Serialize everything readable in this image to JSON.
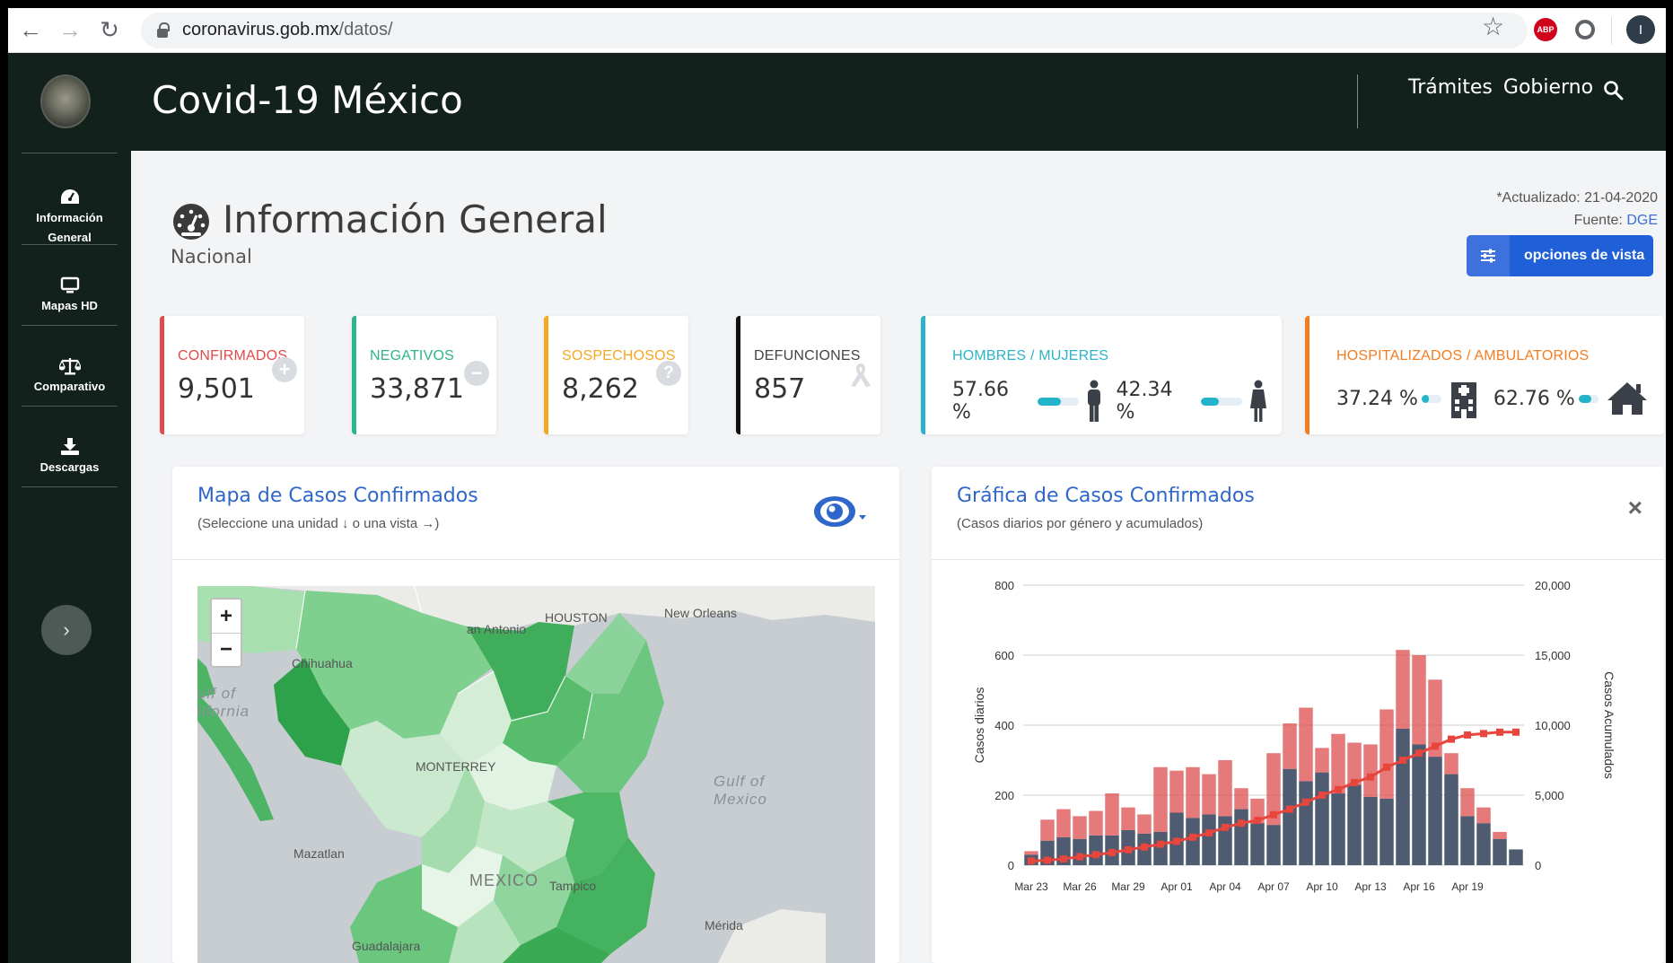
{
  "browser": {
    "url_domain": "coronavirus.gob.mx",
    "url_path": "/datos/",
    "abp_label": "ABP",
    "profile_initial": "I"
  },
  "header": {
    "title": "Covid-19 México",
    "nav": [
      "Trámites",
      "Gobierno"
    ]
  },
  "sidebar": {
    "items": [
      {
        "label_line1": "Información",
        "label_line2": "General",
        "icon": "gauge-icon"
      },
      {
        "label_line1": "Mapas HD",
        "label_line2": "",
        "icon": "monitor-icon"
      },
      {
        "label_line1": "Comparativo",
        "label_line2": "",
        "icon": "balance-scale-icon"
      },
      {
        "label_line1": "Descargas",
        "label_line2": "",
        "icon": "download-icon"
      }
    ],
    "toggle_glyph": "›"
  },
  "page": {
    "title": "Información General",
    "subtitle": "Nacional",
    "updated": "*Actualizado: 21-04-2020",
    "source_label": "Fuente:",
    "source_value": "DGE",
    "options_label": "opciones de vista"
  },
  "cards": {
    "confirmados": {
      "label": "CONFIRMADOS",
      "value": "9,501",
      "color": "#e04b4b"
    },
    "negativos": {
      "label": "NEGATIVOS",
      "value": "33,871",
      "color": "#2cb58a"
    },
    "sospechosos": {
      "label": "SOSPECHOSOS",
      "value": "8,262",
      "color": "#f5a623"
    },
    "defunciones": {
      "label": "DEFUNCIONES",
      "value": "857",
      "color": "#111111"
    },
    "genero": {
      "label": "HOMBRES / MUJERES",
      "hombres": "57.66 %",
      "mujeres": "42.34 %",
      "hombres_frac": 0.5766,
      "mujeres_frac": 0.4234,
      "color": "#2bb3c7"
    },
    "hospital": {
      "label": "HOSPITALIZADOS / AMBULATORIOS",
      "hospitalizados": "37.24 %",
      "ambulatorios": "62.76 %",
      "hospitalizados_frac": 0.3724,
      "ambulatorios_frac": 0.6276,
      "color": "#f47c20"
    }
  },
  "map_panel": {
    "title": "Mapa de Casos Confirmados",
    "subtitle": "(Seleccione una unidad ↓ o una vista →)",
    "zoom_in": "+",
    "zoom_out": "−",
    "labels": {
      "houston": "HOUSTON",
      "san_antonio": "an Antonio",
      "new_orleans": "New Orleans",
      "chihuahua": "Chihuahua",
      "gulf_cal_1": "ulf of",
      "gulf_cal_2": "lifornia",
      "monterrey": "MONTERREY",
      "gulf_mex_1": "Gulf of",
      "gulf_mex_2": "Mexico",
      "mazatlan": "Mazatlan",
      "mexico": "MEXICO",
      "tampico": "Tampico",
      "guadalajara": "Guadalajara",
      "merida": "Mérida"
    }
  },
  "chart_panel": {
    "title": "Gráfica de Casos Confirmados",
    "subtitle": "(Casos diarios por género y acumulados)",
    "close": "×"
  },
  "chart_data": {
    "type": "bar",
    "ylabel": "Casos diarios",
    "y2label": "Casos Acumulados",
    "ylim": [
      0,
      800
    ],
    "y2lim": [
      0,
      20000
    ],
    "yticks": [
      "0",
      "200",
      "400",
      "600",
      "800"
    ],
    "y2ticks": [
      "0",
      "5,000",
      "10,000",
      "15,000",
      "20,000"
    ],
    "xticks": [
      "Mar 23",
      "Mar 26",
      "Mar 29",
      "Apr 01",
      "Apr 04",
      "Apr 07",
      "Apr 10",
      "Apr 13",
      "Apr 16",
      "Apr 19"
    ],
    "grid": true,
    "stacked": true,
    "series": [
      {
        "values": [
          30,
          70,
          80,
          75,
          85,
          85,
          100,
          90,
          95,
          150,
          135,
          145,
          140,
          160,
          120,
          115,
          275,
          240,
          265,
          205,
          230,
          195,
          190,
          390,
          345,
          310,
          260,
          140,
          120,
          75,
          45
        ],
        "color": "#4f5b70"
      },
      {
        "values": [
          10,
          60,
          80,
          65,
          70,
          120,
          65,
          55,
          185,
          120,
          145,
          115,
          160,
          60,
          70,
          205,
          130,
          210,
          70,
          170,
          120,
          150,
          255,
          225,
          255,
          220,
          60,
          80,
          45,
          20
        ],
        "color": "#e05757"
      },
      {
        "values": [
          300,
          350,
          450,
          600,
          750,
          900,
          1100,
          1300,
          1500,
          1700,
          2000,
          2300,
          2700,
          3000,
          3200,
          3600,
          4000,
          4500,
          5000,
          5400,
          5900,
          6300,
          7000,
          7500,
          8000,
          8500,
          9000,
          9300,
          9400,
          9500,
          9501
        ],
        "color": "#e8453c",
        "type": "line"
      }
    ]
  }
}
